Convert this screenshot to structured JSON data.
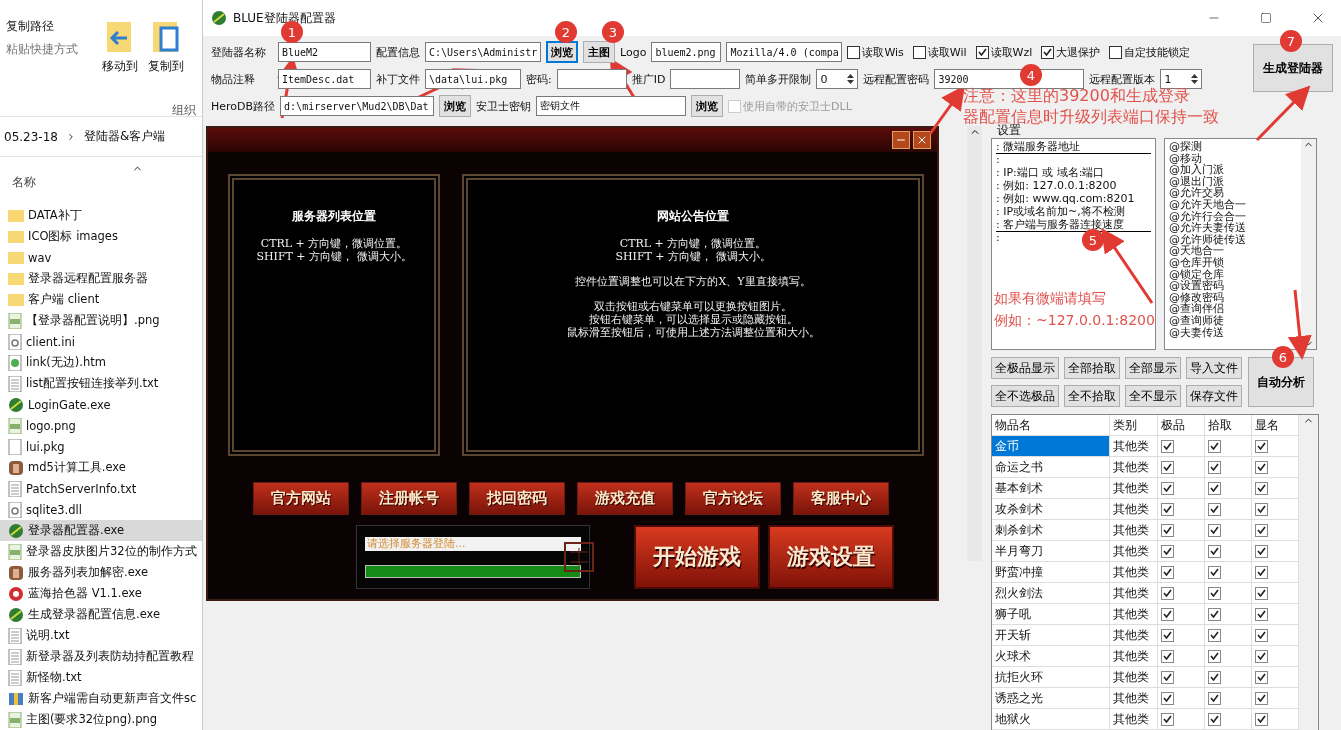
{
  "explorer": {
    "ribbon": {
      "small_actions": [
        {
          "label": "复制路径",
          "disabled": false
        },
        {
          "label": "粘贴快捷方式",
          "disabled": true
        }
      ],
      "big_actions": [
        "移动到",
        "复制到"
      ],
      "group_label": "组织"
    },
    "breadcrumb": [
      "05.23-18",
      "登陆器&客户端"
    ],
    "column": "名称",
    "files": [
      {
        "name": "DATA补丁",
        "kind": "folder",
        "selected": false
      },
      {
        "name": "ICO图标 images",
        "kind": "folder",
        "selected": false
      },
      {
        "name": "wav",
        "kind": "folder",
        "selected": false
      },
      {
        "name": "登录器远程配置服务器",
        "kind": "folder",
        "selected": false
      },
      {
        "name": "客户端 client",
        "kind": "folder",
        "selected": false
      },
      {
        "name": "【登录器配置说明】.png",
        "kind": "image",
        "selected": false
      },
      {
        "name": "client.ini",
        "kind": "config",
        "selected": false
      },
      {
        "name": "link(无边).htm",
        "kind": "web",
        "selected": false
      },
      {
        "name": "list配置按钮连接举列.txt",
        "kind": "text",
        "selected": false
      },
      {
        "name": "LoginGate.exe",
        "kind": "app",
        "selected": false
      },
      {
        "name": "logo.png",
        "kind": "image",
        "selected": false
      },
      {
        "name": "lui.pkg",
        "kind": "blank",
        "selected": false
      },
      {
        "name": "md5计算工具.exe",
        "kind": "tool",
        "selected": false
      },
      {
        "name": "PatchServerInfo.txt",
        "kind": "text",
        "selected": false
      },
      {
        "name": "sqlite3.dll",
        "kind": "config",
        "selected": false
      },
      {
        "name": "登录器配置器.exe",
        "kind": "app",
        "selected": true
      },
      {
        "name": "登录器皮肤图片32位的制作方式",
        "kind": "image",
        "selected": false
      },
      {
        "name": "服务器列表加解密.exe",
        "kind": "tool",
        "selected": false
      },
      {
        "name": "蓝海拾色器 V1.1.exe",
        "kind": "picker",
        "selected": false
      },
      {
        "name": "生成登录器配置信息.exe",
        "kind": "app",
        "selected": false
      },
      {
        "name": "说明.txt",
        "kind": "text",
        "selected": false
      },
      {
        "name": "新登录器及列表防劫持配置教程",
        "kind": "text",
        "selected": false
      },
      {
        "name": "新怪物.txt",
        "kind": "text",
        "selected": false
      },
      {
        "name": "新客户端需自动更新声音文件sc",
        "kind": "archive",
        "selected": false
      },
      {
        "name": "主图(要求32位png).png",
        "kind": "image",
        "selected": false
      }
    ]
  },
  "window": {
    "title": "BLUE登陆器配置器"
  },
  "toolbar": {
    "lines": [
      {
        "controls": [
          {
            "kind": "label",
            "text": "登陆器名称"
          },
          {
            "kind": "input",
            "value": "BlueM2"
          },
          {
            "kind": "label",
            "text": "配置信息"
          },
          {
            "kind": "input",
            "value": "C:\\Users\\Administr"
          },
          {
            "kind": "button",
            "text": "浏览",
            "focused": true
          },
          {
            "kind": "button",
            "text": "主图",
            "focused": false
          },
          {
            "kind": "label",
            "text": "Logo"
          },
          {
            "kind": "input",
            "value": "bluem2.png"
          },
          {
            "kind": "input",
            "value": "Mozilla/4.0 (compa"
          },
          {
            "kind": "checkbox",
            "text": "读取Wis",
            "checked": false,
            "disabled": false
          },
          {
            "kind": "checkbox",
            "text": "读取Wil",
            "checked": false,
            "disabled": false
          },
          {
            "kind": "checkbox",
            "text": "读取Wzl",
            "checked": true,
            "disabled": false
          },
          {
            "kind": "checkbox",
            "text": "大退保护",
            "checked": true,
            "disabled": false
          },
          {
            "kind": "checkbox",
            "text": "自定技能锁定",
            "checked": false,
            "disabled": false
          }
        ]
      },
      {
        "controls": [
          {
            "kind": "label",
            "text": "物品注释"
          },
          {
            "kind": "input",
            "value": "ItemDesc.dat"
          },
          {
            "kind": "label",
            "text": "补丁文件"
          },
          {
            "kind": "input",
            "value": "\\data\\lui.pkg"
          },
          {
            "kind": "label",
            "text": "密码:"
          },
          {
            "kind": "input"
          },
          {
            "kind": "label",
            "text": "推广ID"
          },
          {
            "kind": "input"
          },
          {
            "kind": "label",
            "text": "简单多开限制"
          },
          {
            "kind": "spinner",
            "value": "0"
          },
          {
            "kind": "label",
            "text": "远程配置密码"
          },
          {
            "kind": "input",
            "value": "39200"
          },
          {
            "kind": "label",
            "text": "远程配置版本"
          },
          {
            "kind": "spinner",
            "value": "1"
          }
        ]
      },
      {
        "controls": [
          {
            "kind": "label",
            "text": "HeroDB路径"
          },
          {
            "kind": "input",
            "value": "d:\\mirserver\\Mud2\\DB\\Dat"
          },
          {
            "kind": "button",
            "text": "浏览",
            "focused": false
          },
          {
            "kind": "label",
            "text": "安卫士密钥"
          },
          {
            "kind": "input",
            "value": "密钥文件"
          },
          {
            "kind": "button",
            "text": "浏览",
            "focused": false
          },
          {
            "kind": "checkbox",
            "text": "使用自带的安卫士DLL",
            "checked": false,
            "disabled": true
          }
        ]
      }
    ],
    "generate_button": "生成登陆器"
  },
  "preview": {
    "server_panel": {
      "title": "服务器列表位置",
      "lines": [
        "CTRL + 方向键，微调位置。",
        "SHIFT + 方向键， 微调大小。"
      ]
    },
    "notice_panel": {
      "title": "网站公告位置",
      "paragraphs": [
        [
          "CTRL + 方向键，微调位置。",
          "SHIFT + 方向键， 微调大小。"
        ],
        [
          "控件位置调整也可以在下方的X、Y里直接填写。"
        ],
        [
          "双击按钮或右键菜单可以更换按钮图片。",
          "按钮右键菜单，可以选择显示或隐藏按钮。",
          "鼠标滑至按钮后，可使用上述方法调整位置和大小。"
        ]
      ]
    },
    "link_buttons": [
      "官方网站",
      "注册帐号",
      "找回密码",
      "游戏充值",
      "官方论坛",
      "客服中心"
    ],
    "status_text": "请选择服务器登陆...",
    "progress": {
      "level": 1
    },
    "main_buttons": [
      "开始游戏",
      "游戏设置"
    ]
  },
  "settings": {
    "group_label": "设置",
    "memo_lines": [
      {
        "text": ": 微端服务器地址",
        "rule": true
      },
      {
        "text": ":",
        "rule": false
      },
      {
        "text": ": IP:端口 或 域名:端口",
        "rule": false
      },
      {
        "text": ": 例如: 127.0.0.1:8200",
        "rule": false
      },
      {
        "text": ": 例如: www.qq.com:8201",
        "rule": false
      },
      {
        "text": ": IP或域名前加~,将不检测",
        "rule": false
      },
      {
        "text": ": 客户端与服务器连接速度",
        "rule": true
      },
      {
        "text": ":",
        "rule": false
      }
    ],
    "commands": [
      "@探测",
      "@移动",
      "@加入门派",
      "@退出门派",
      "@允许交易",
      "@允许天地合一",
      "@允许行会合一",
      "@允许夫妻传送",
      "@允许师徒传送",
      "@天地合一",
      "@仓库开锁",
      "@锁定仓库",
      "@设置密码",
      "@修改密码",
      "@查询伴侣",
      "@查询师徒",
      "@夫妻传送"
    ],
    "buttons": [
      "全极品显示",
      "全部拾取",
      "全部显示",
      "导入文件",
      "全不选极品",
      "全不拾取",
      "全不显示",
      "保存文件"
    ],
    "analyze_button": "自动分析",
    "table": {
      "columns": [
        "物品名",
        "类别",
        "极品",
        "拾取",
        "显名"
      ],
      "rows": [
        {
          "name": "金币",
          "category": "其他类",
          "best": true,
          "pickup": true,
          "show": true,
          "selected": true
        },
        {
          "name": "命运之书",
          "category": "其他类",
          "best": true,
          "pickup": true,
          "show": true,
          "selected": false
        },
        {
          "name": "基本剑术",
          "category": "其他类",
          "best": true,
          "pickup": true,
          "show": true,
          "selected": false
        },
        {
          "name": "攻杀剑术",
          "category": "其他类",
          "best": true,
          "pickup": true,
          "show": true,
          "selected": false
        },
        {
          "name": "刺杀剑术",
          "category": "其他类",
          "best": true,
          "pickup": true,
          "show": true,
          "selected": false
        },
        {
          "name": "半月弯刀",
          "category": "其他类",
          "best": true,
          "pickup": true,
          "show": true,
          "selected": false
        },
        {
          "name": "野蛮冲撞",
          "category": "其他类",
          "best": true,
          "pickup": true,
          "show": true,
          "selected": false
        },
        {
          "name": "烈火剑法",
          "category": "其他类",
          "best": true,
          "pickup": true,
          "show": true,
          "selected": false
        },
        {
          "name": "狮子吼",
          "category": "其他类",
          "best": true,
          "pickup": true,
          "show": true,
          "selected": false
        },
        {
          "name": "开天斩",
          "category": "其他类",
          "best": true,
          "pickup": true,
          "show": true,
          "selected": false
        },
        {
          "name": "火球术",
          "category": "其他类",
          "best": true,
          "pickup": true,
          "show": true,
          "selected": false
        },
        {
          "name": "抗拒火环",
          "category": "其他类",
          "best": true,
          "pickup": true,
          "show": true,
          "selected": false
        },
        {
          "name": "诱惑之光",
          "category": "其他类",
          "best": true,
          "pickup": true,
          "show": true,
          "selected": false
        },
        {
          "name": "地狱火",
          "category": "其他类",
          "best": true,
          "pickup": true,
          "show": true,
          "selected": false
        }
      ]
    }
  },
  "annotations": {
    "markers": [
      "1",
      "2",
      "3",
      "4",
      "5",
      "6",
      "7"
    ],
    "notes": [
      [
        "注意：这里的39200和生成登录",
        "器配置信息时升级列表端口保持一致"
      ],
      [
        "如果有微端请填写",
        "例如：~127.0.0.1:8200"
      ]
    ]
  }
}
